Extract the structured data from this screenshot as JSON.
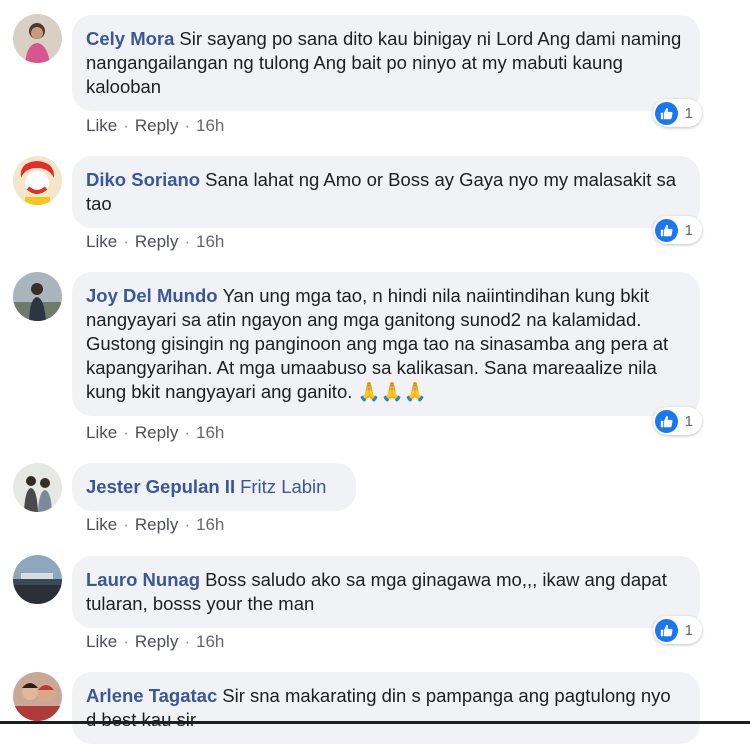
{
  "comments": [
    {
      "author": "Cely Mora",
      "text": "Sir sayang po sana dito kau binigay ni Lord Ang dami naming nangangailangan ng tulong Ang bait po ninyo at my mabuti kaung kalooban",
      "like": "Like",
      "reply": "Reply",
      "time": "16h",
      "reactions": "1"
    },
    {
      "author": "Diko Soriano",
      "text": "Sana lahat ng Amo or Boss ay Gaya nyo my malasakit sa tao",
      "like": "Like",
      "reply": "Reply",
      "time": "16h",
      "reactions": "1"
    },
    {
      "author": "Joy Del Mundo",
      "text": "Yan ung mga tao, n hindi nila naiintindihan kung bkit nangyayari sa atin ngayon ang mga ganitong sunod2 na kalamidad. Gustong gisingin ng panginoon ang mga tao na sinasamba ang pera at kapangyarihan. At mga umaabuso sa kalikasan. Sana mareaalize nila kung bkit nangyayari ang ganito.",
      "emoji": "🙏🙏🙏",
      "like": "Like",
      "reply": "Reply",
      "time": "16h",
      "reactions": "1"
    },
    {
      "author": "Jester Gepulan II",
      "text": "Fritz Labin",
      "like": "Like",
      "reply": "Reply",
      "time": "16h"
    },
    {
      "author": "Lauro Nunag",
      "text": "Boss saludo ako sa mga ginagawa mo,,, ikaw ang dapat tularan, bosss your the man",
      "like": "Like",
      "reply": "Reply",
      "time": "16h",
      "reactions": "1"
    },
    {
      "author": "Arlene Tagatac",
      "text": "Sir sna makarating din s pampanga ang pagtulong nyo d best kau sir"
    }
  ],
  "icons": {
    "like_reaction": "thumbs-up-icon"
  },
  "colors": {
    "author": "#385898",
    "bubble": "#f0f2f5",
    "like_blue": "#1877f2"
  }
}
